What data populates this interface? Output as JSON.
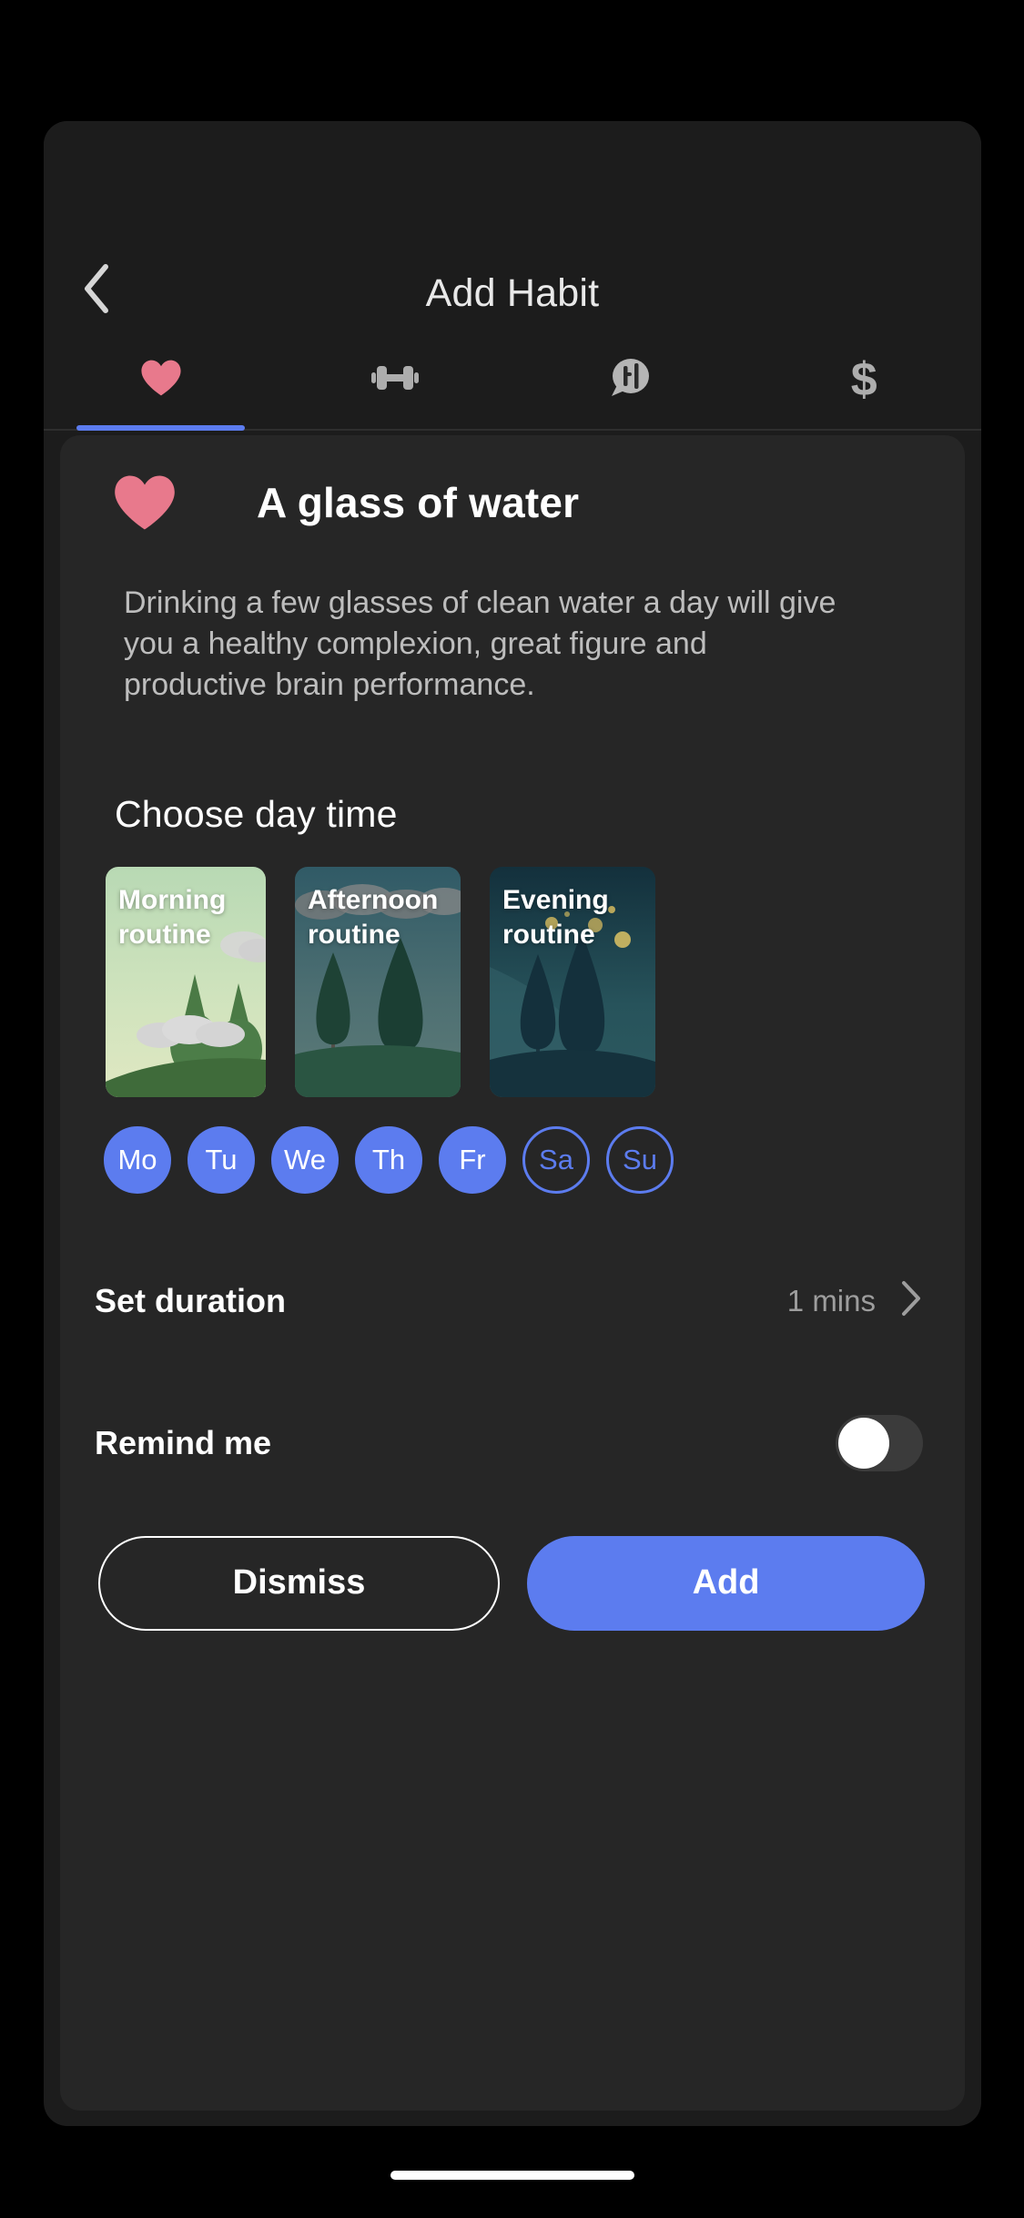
{
  "header": {
    "title": "Add Habit",
    "back_icon": "chevron-left-icon"
  },
  "tabs": [
    {
      "id": "health",
      "icon": "heart-icon",
      "active": true
    },
    {
      "id": "fitness",
      "icon": "dumbbell-icon",
      "active": false
    },
    {
      "id": "study",
      "icon": "speech-bubble-icon",
      "active": false
    },
    {
      "id": "finance",
      "icon": "dollar-sign-icon",
      "active": false
    }
  ],
  "habit": {
    "icon": "heart-icon",
    "title": "A glass of water",
    "description": "Drinking a few glasses of clean water a day will give you a healthy complexion, great figure and productive brain performance."
  },
  "day_time": {
    "section_title": "Choose day time",
    "options": [
      {
        "id": "morning",
        "label": "Morning routine",
        "selected": true
      },
      {
        "id": "afternoon",
        "label": "Afternoon routine",
        "selected": false
      },
      {
        "id": "evening",
        "label": "Evening routine",
        "selected": false
      }
    ]
  },
  "weekdays": [
    {
      "label": "Mo",
      "selected": true
    },
    {
      "label": "Tu",
      "selected": true
    },
    {
      "label": "We",
      "selected": true
    },
    {
      "label": "Th",
      "selected": true
    },
    {
      "label": "Fr",
      "selected": true
    },
    {
      "label": "Sa",
      "selected": false
    },
    {
      "label": "Su",
      "selected": false
    }
  ],
  "duration": {
    "label": "Set duration",
    "value": "1 mins",
    "chevron_icon": "chevron-right-icon"
  },
  "remind": {
    "label": "Remind me",
    "enabled": false
  },
  "actions": {
    "dismiss_label": "Dismiss",
    "add_label": "Add"
  },
  "colors": {
    "accent_blue": "#5C7CEF",
    "heart_pink": "#E8798C",
    "sheet_bg": "#262626",
    "app_bg": "#1c1c1c",
    "device_bg": "#000000",
    "muted_text": "#9d9d9d"
  }
}
